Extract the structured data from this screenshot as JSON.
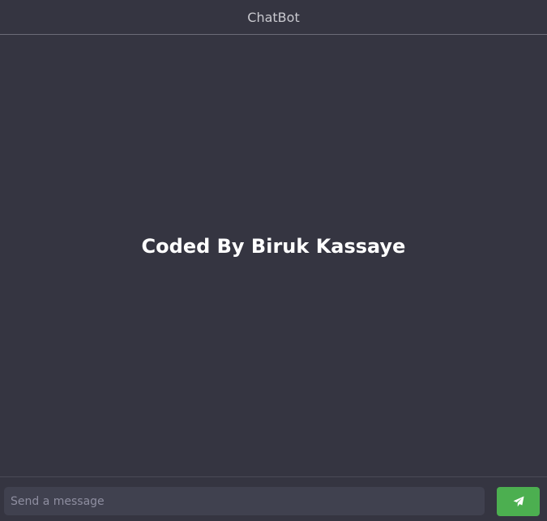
{
  "header": {
    "title": "ChatBot"
  },
  "main": {
    "splash_text": "Coded By Biruk Kassaye"
  },
  "composer": {
    "value": "",
    "placeholder": "Send a message",
    "send_icon": "paper-plane-icon"
  },
  "colors": {
    "background": "#353541",
    "input_background": "#40414f",
    "send_button": "#4caf50",
    "header_text": "#c9c9cf",
    "splash_text": "#ffffff"
  }
}
